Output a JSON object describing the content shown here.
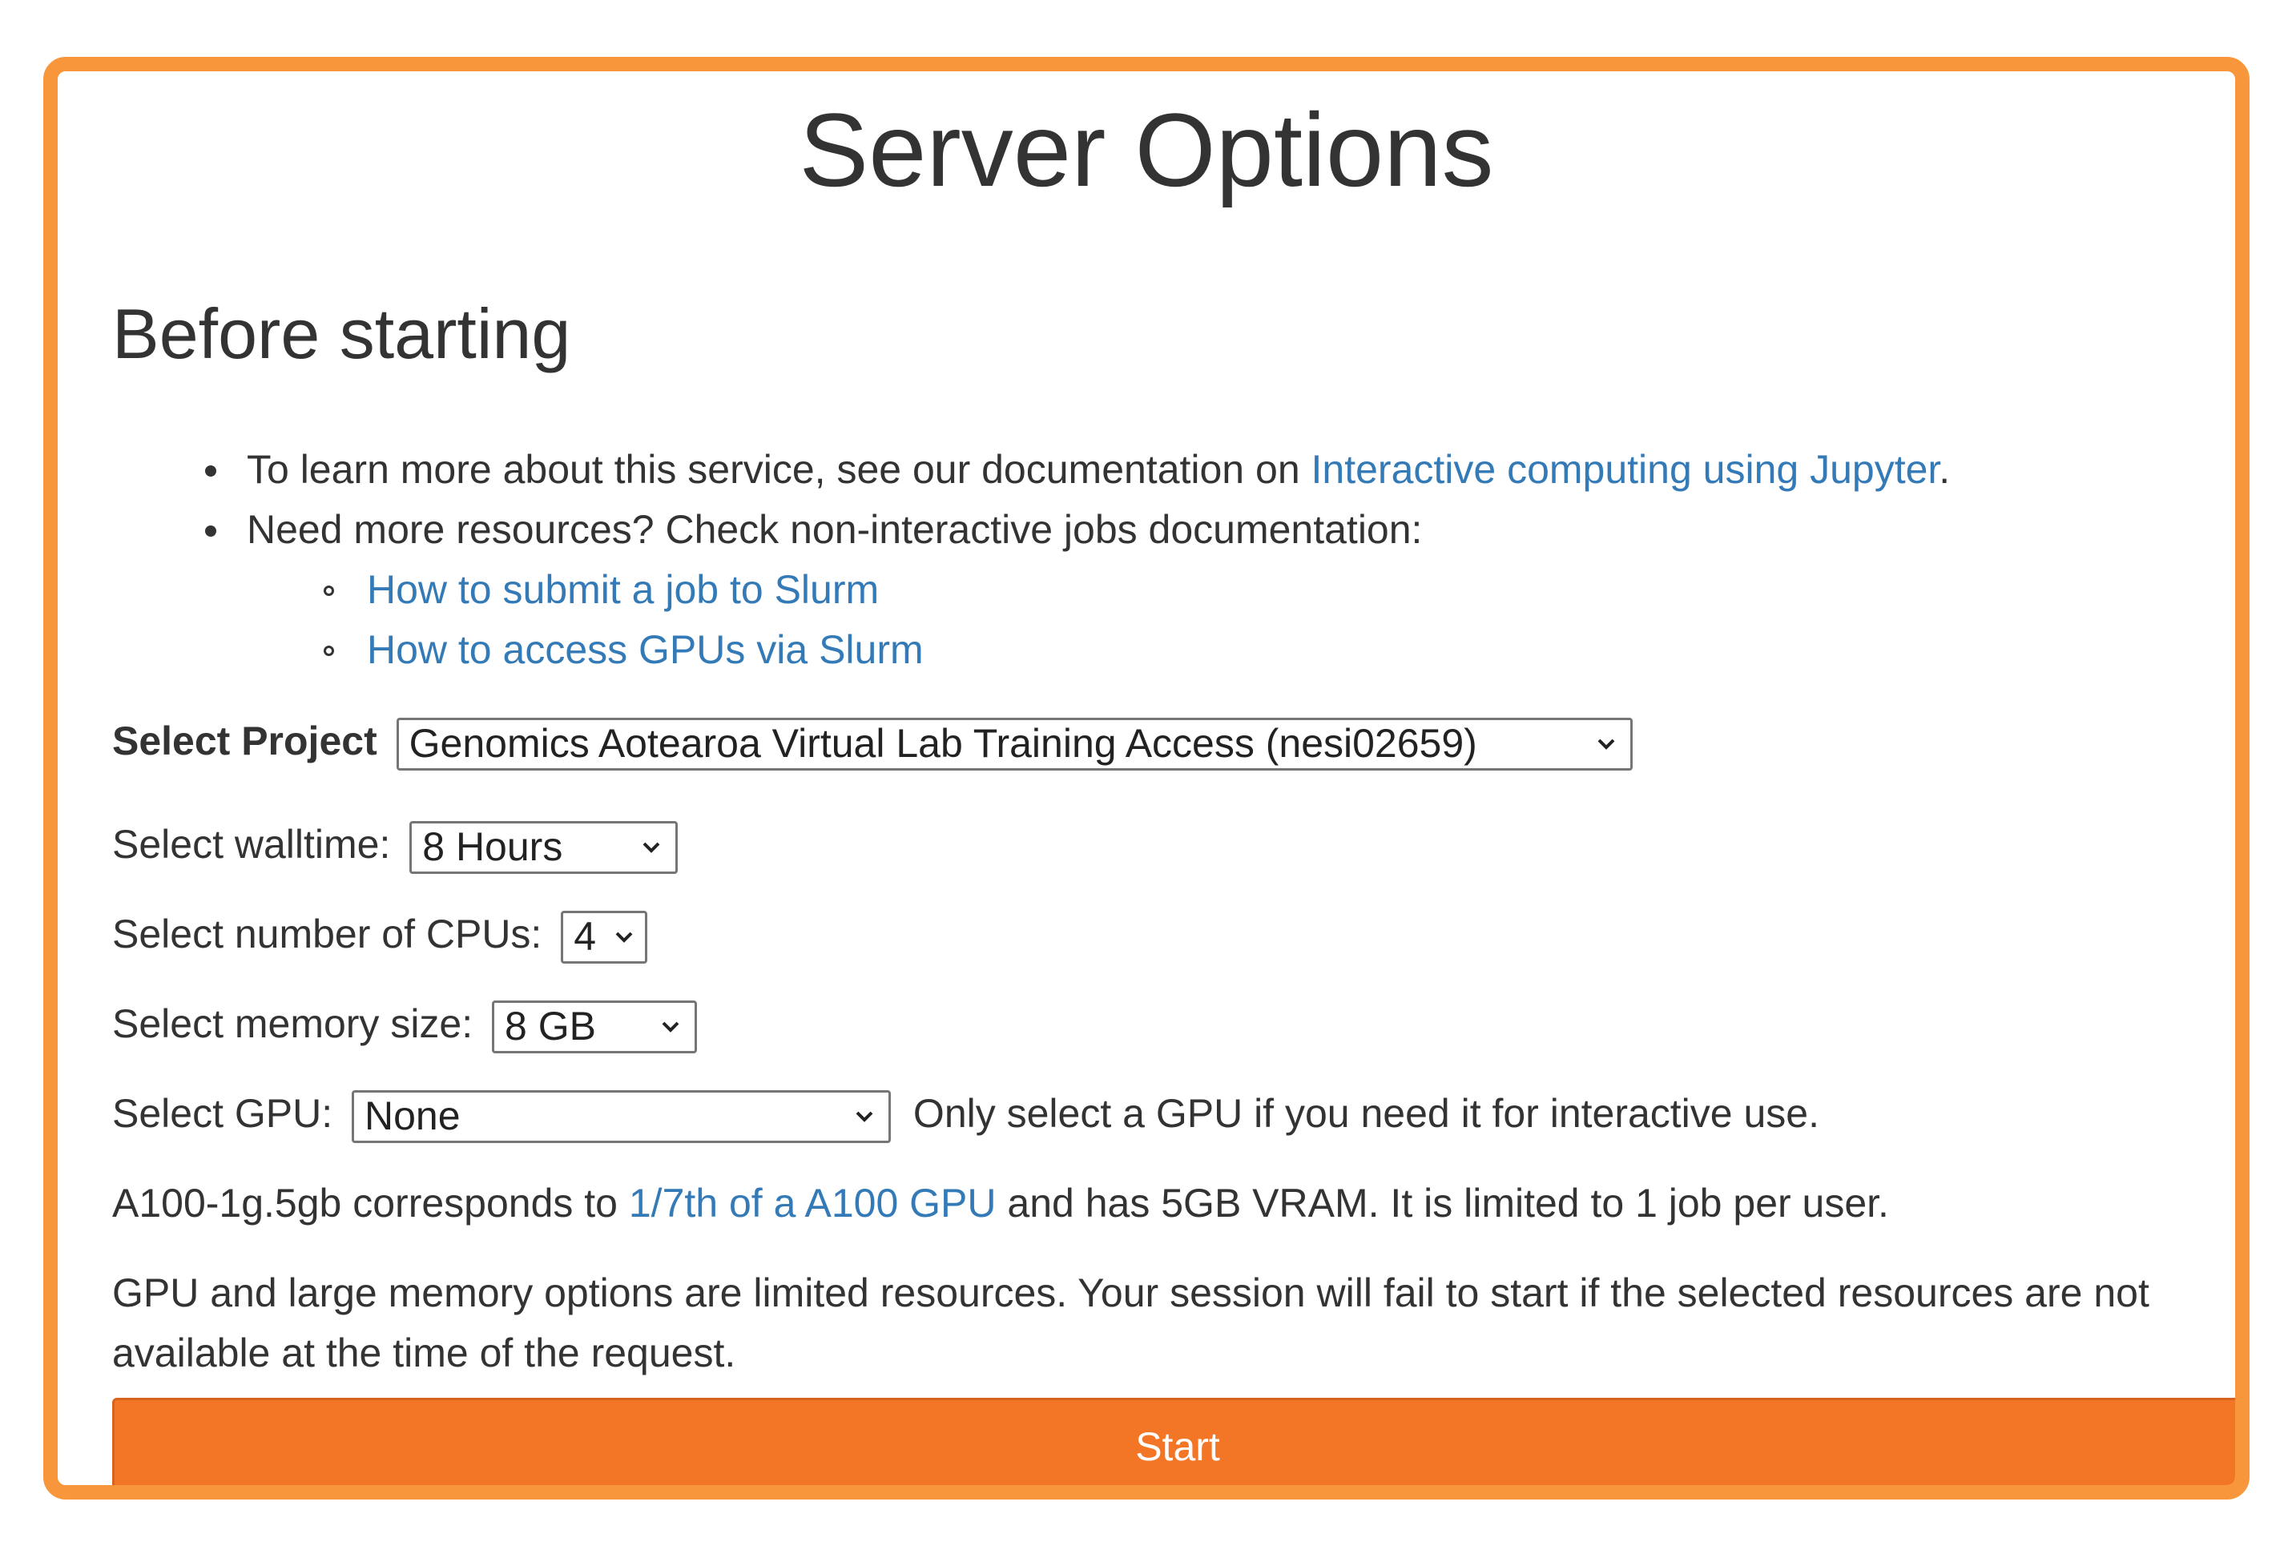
{
  "page": {
    "title": "Server Options"
  },
  "before_starting": {
    "heading": "Before starting",
    "bullet1_prefix": "To learn more about this service, see our documentation on ",
    "bullet1_link": "Interactive computing using Jupyter",
    "bullet1_suffix": ".",
    "bullet2_text": "Need more resources? Check non-interactive jobs documentation:",
    "sub_links": [
      "How to submit a job to Slurm",
      "How to access GPUs via Slurm"
    ]
  },
  "form": {
    "project_label": "Select Project",
    "project_value": "Genomics Aotearoa Virtual Lab Training Access (nesi02659)",
    "walltime_label": "Select walltime:",
    "walltime_value": "8 Hours",
    "cpus_label": "Select number of CPUs:",
    "cpus_value": "4",
    "memory_label": "Select memory size:",
    "memory_value": "8 GB",
    "gpu_label": "Select GPU:",
    "gpu_value": "None",
    "gpu_note": "Only select a GPU if you need it for interactive use."
  },
  "info": {
    "a100_prefix": "A100-1g.5gb corresponds to ",
    "a100_link": "1/7th of a A100 GPU",
    "a100_suffix": " and has 5GB VRAM. It is limited to 1 job per user.",
    "limits_line1": "GPU and large memory options are limited resources. Your session will fail to start if the selected resources are not",
    "limits_line2": "available at the time of the request."
  },
  "actions": {
    "start_label": "Start"
  },
  "colors": {
    "frame": "#f7963a",
    "button": "#f37626",
    "link": "#337ab7"
  }
}
